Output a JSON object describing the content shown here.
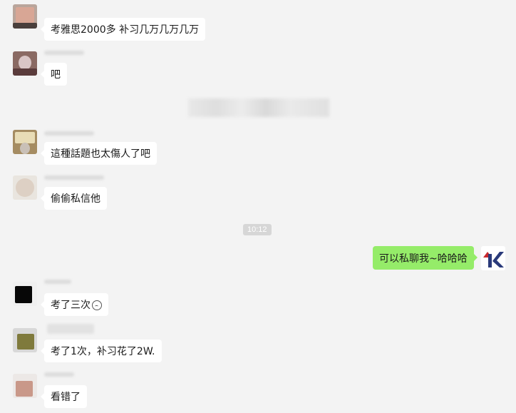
{
  "chat": {
    "notice_blurred": "",
    "timestamp": "10:12",
    "messages": [
      {
        "side": "left",
        "text": "考雅思2000多 补习几万几万几万"
      },
      {
        "side": "left",
        "text": "吧"
      },
      {
        "side": "left",
        "text": "這種話題也太傷人了吧"
      },
      {
        "side": "left",
        "text": "偷偷私信他"
      },
      {
        "side": "right",
        "text": "可以私聊我~哈哈哈"
      },
      {
        "side": "left",
        "text": "考了三次",
        "emoji": "face-emoji"
      },
      {
        "side": "left",
        "text": "考了1次，补习花了2W."
      },
      {
        "side": "left",
        "text": "看错了"
      }
    ]
  },
  "avatars": {
    "logo_letter": "K"
  },
  "colors": {
    "background": "#f3f3f3",
    "left_bubble": "#ffffff",
    "right_bubble": "#95ec69",
    "logo_navy": "#2a3a7a",
    "logo_red": "#c8282e"
  }
}
